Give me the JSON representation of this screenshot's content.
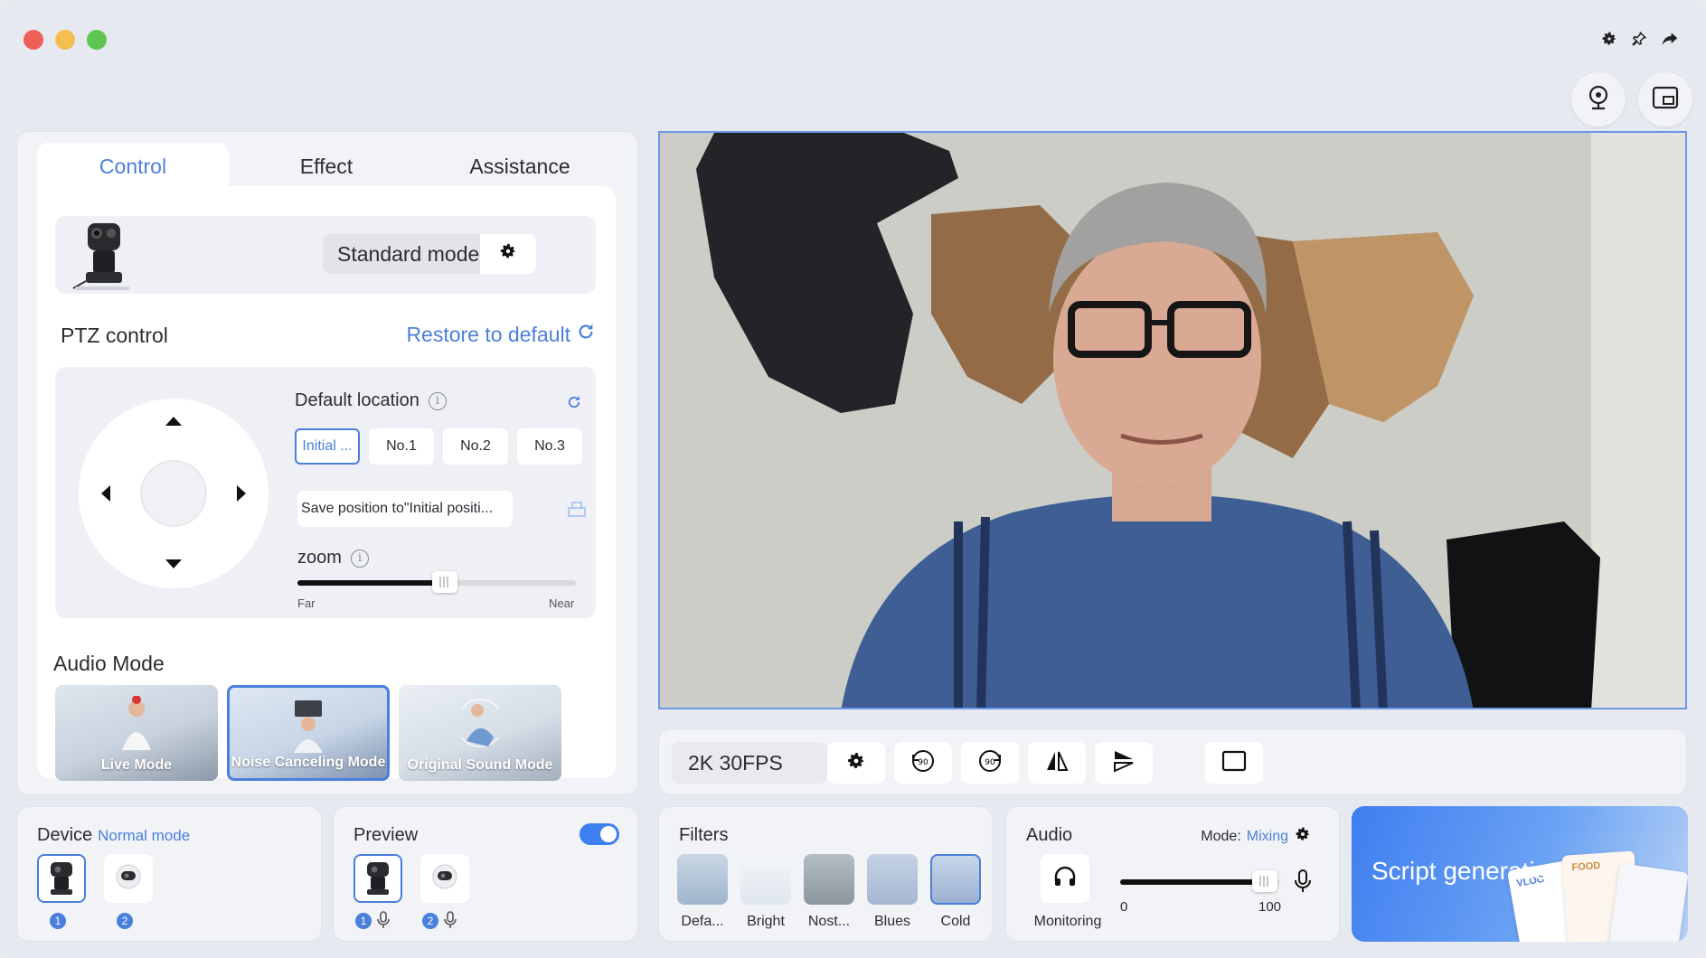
{
  "window": {
    "controls": [
      "close",
      "minimize",
      "maximize"
    ],
    "top_right_icons": [
      "gear-icon",
      "pin-icon",
      "share-icon"
    ],
    "side_buttons": [
      "webcam-icon",
      "screen-cast-icon"
    ]
  },
  "tabs": [
    {
      "label": "Control",
      "active": true
    },
    {
      "label": "Effect",
      "active": false
    },
    {
      "label": "Assistance",
      "active": false
    }
  ],
  "camera_card": {
    "mode": "Standard mode"
  },
  "ptz": {
    "title": "PTZ control",
    "restore_label": "Restore to default",
    "default_location_label": "Default location",
    "presets": [
      "Initial ...",
      "No.1",
      "No.2",
      "No.3"
    ],
    "save_position_label": "Save position to\"Initial positi...",
    "zoom_label": "zoom",
    "zoom_value": 0.53,
    "zoom_min_label": "Far",
    "zoom_max_label": "Near"
  },
  "audio_mode": {
    "title": "Audio Mode",
    "modes": [
      {
        "label": "Live Mode",
        "selected": false
      },
      {
        "label": "Noise Canceling Mode",
        "selected": true
      },
      {
        "label": "Original Sound Mode",
        "selected": false
      }
    ]
  },
  "toolbar": {
    "resolution": "2K 30FPS",
    "buttons": [
      "settings-icon",
      "rotate-left-90-icon",
      "rotate-right-90-icon",
      "flip-horizontal-icon",
      "flip-vertical-icon",
      "window-icon"
    ]
  },
  "device": {
    "title": "Device",
    "mode": "Normal mode",
    "devices": [
      {
        "num": "1",
        "selected": true
      },
      {
        "num": "2",
        "selected": false
      }
    ]
  },
  "preview": {
    "title": "Preview",
    "enabled": true,
    "devices": [
      {
        "num": "1"
      },
      {
        "num": "2"
      }
    ]
  },
  "filters": {
    "title": "Filters",
    "items": [
      {
        "label": "Defa...",
        "selected": false
      },
      {
        "label": "Bright",
        "selected": false
      },
      {
        "label": "Nost...",
        "selected": false
      },
      {
        "label": "Blues",
        "selected": false
      },
      {
        "label": "Cold",
        "selected": true
      }
    ]
  },
  "audio": {
    "title": "Audio",
    "mode_label": "Mode:",
    "mode_value": "Mixing",
    "monitoring_label": "Monitoring",
    "volume_min": "0",
    "volume_max": "100",
    "volume_value": 0.91
  },
  "script": {
    "title": "Script generation",
    "card_texts": [
      "VLOG",
      "FOOD"
    ]
  },
  "colors": {
    "accent": "#4a7fdc",
    "toggle_on": "#3d7ff0",
    "close": "#ee5f57",
    "minimize": "#f4bd4f",
    "maximize": "#5ec650"
  }
}
